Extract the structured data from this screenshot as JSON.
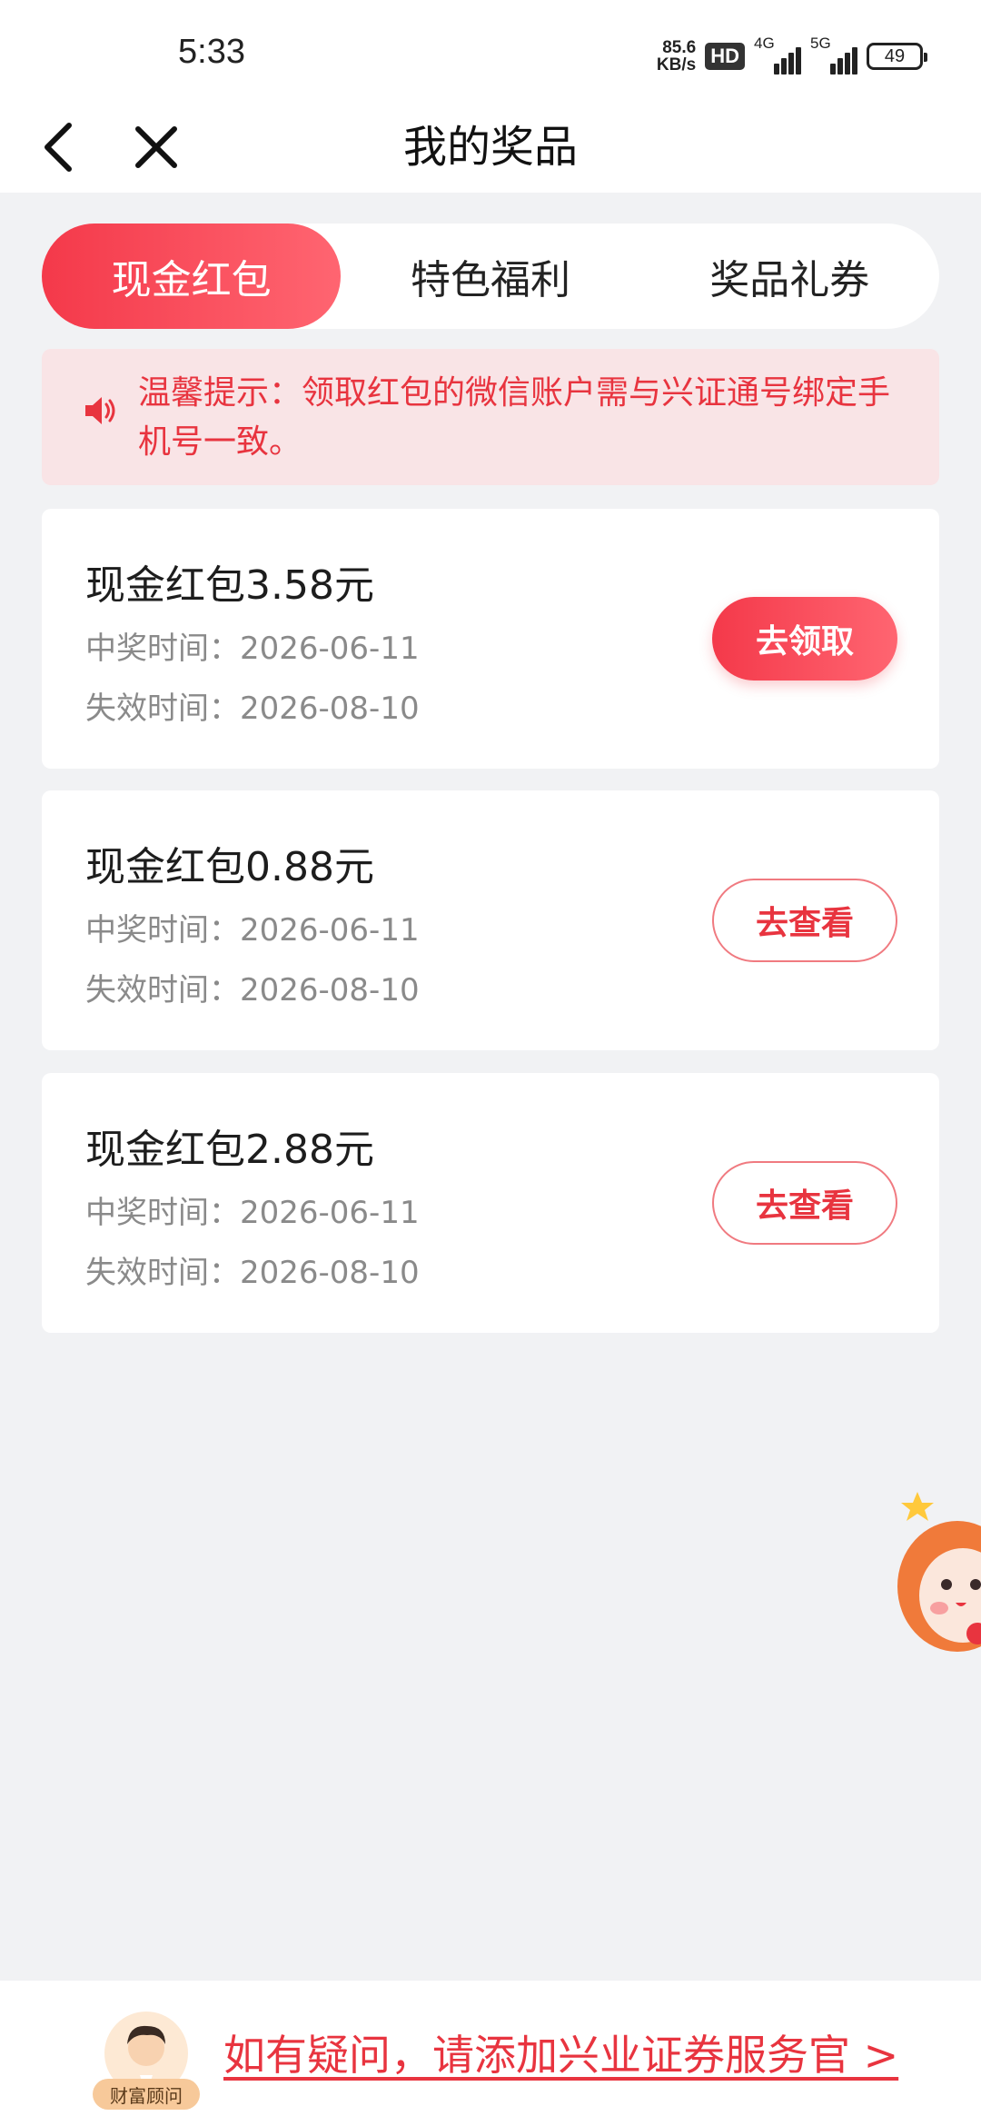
{
  "status_bar": {
    "time": "5:33",
    "net_speed_value": "85.6",
    "net_speed_unit": "KB/s",
    "hd_badge": "HD",
    "signal1_label": "4G",
    "signal2_label": "5G",
    "battery": "49"
  },
  "navbar": {
    "title": "我的奖品"
  },
  "tabs": [
    {
      "label": "现金红包",
      "active": true
    },
    {
      "label": "特色福利",
      "active": false
    },
    {
      "label": "奖品礼券",
      "active": false
    }
  ],
  "notice": {
    "text": "温馨提示：领取红包的微信账户需与兴证通号绑定手机号一致。"
  },
  "prizes": [
    {
      "title": "现金红包3.58元",
      "win_time": "中奖时间：2026-06-11",
      "expire_time": "失效时间：2026-08-10",
      "button": "去领取"
    },
    {
      "title": "现金红包0.88元",
      "win_time": "中奖时间：2026-06-11",
      "expire_time": "失效时间：2026-08-10",
      "button": "去查看"
    },
    {
      "title": "现金红包2.88元",
      "win_time": "中奖时间：2026-06-11",
      "expire_time": "失效时间：2026-08-10",
      "button": "去查看"
    }
  ],
  "footer": {
    "advisor_tag": "财富顾问",
    "help_link": "如有疑问，请添加兴业证券服务官 >"
  },
  "colors": {
    "accent": "#f4394a",
    "accent_text": "#e8343f",
    "notice_bg": "#f9e4e6",
    "page_bg": "#f1f2f4"
  }
}
